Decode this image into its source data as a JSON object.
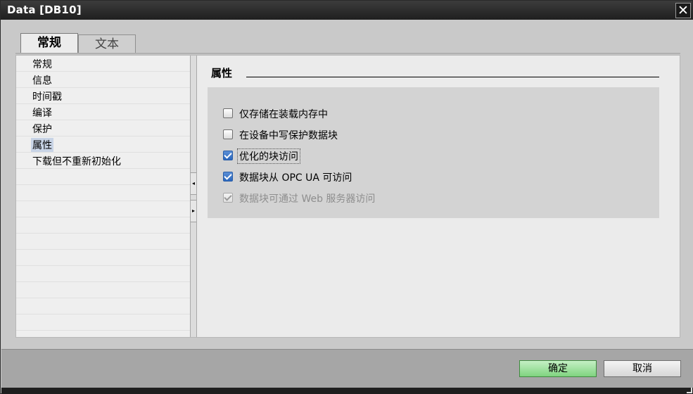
{
  "window": {
    "title": "Data [DB10]",
    "close_glyph": "✕"
  },
  "tabs": [
    {
      "label": "常规",
      "active": true
    },
    {
      "label": "文本",
      "active": false
    }
  ],
  "nav": {
    "items": [
      {
        "label": "常规"
      },
      {
        "label": "信息"
      },
      {
        "label": "时间戳"
      },
      {
        "label": "编译"
      },
      {
        "label": "保护"
      },
      {
        "label": "属性",
        "selected": true
      },
      {
        "label": "下载但不重新初始化"
      }
    ]
  },
  "splitter": {
    "collapse_icon": "arrow-left-icon",
    "expand_icon": "arrow-right-icon",
    "left_glyph": "◂",
    "right_glyph": "▸"
  },
  "section": {
    "title": "属性",
    "options": [
      {
        "label": "仅存储在装载内存中",
        "checked": false,
        "enabled": true
      },
      {
        "label": "在设备中写保护数据块",
        "checked": false,
        "enabled": true
      },
      {
        "label": "优化的块访问",
        "checked": true,
        "enabled": true,
        "focused": true
      },
      {
        "label": "数据块从 OPC UA 可访问",
        "checked": true,
        "enabled": true
      },
      {
        "label": "数据块可通过 Web 服务器访问",
        "checked": true,
        "enabled": false
      }
    ]
  },
  "footer": {
    "ok_label": "确定",
    "cancel_label": "取消"
  },
  "colors": {
    "title_bar": "#2a2a2a",
    "ok_button": "#8fdc8f",
    "checkbox_checked": "#2a66bd",
    "selection": "#c8d4e6"
  }
}
